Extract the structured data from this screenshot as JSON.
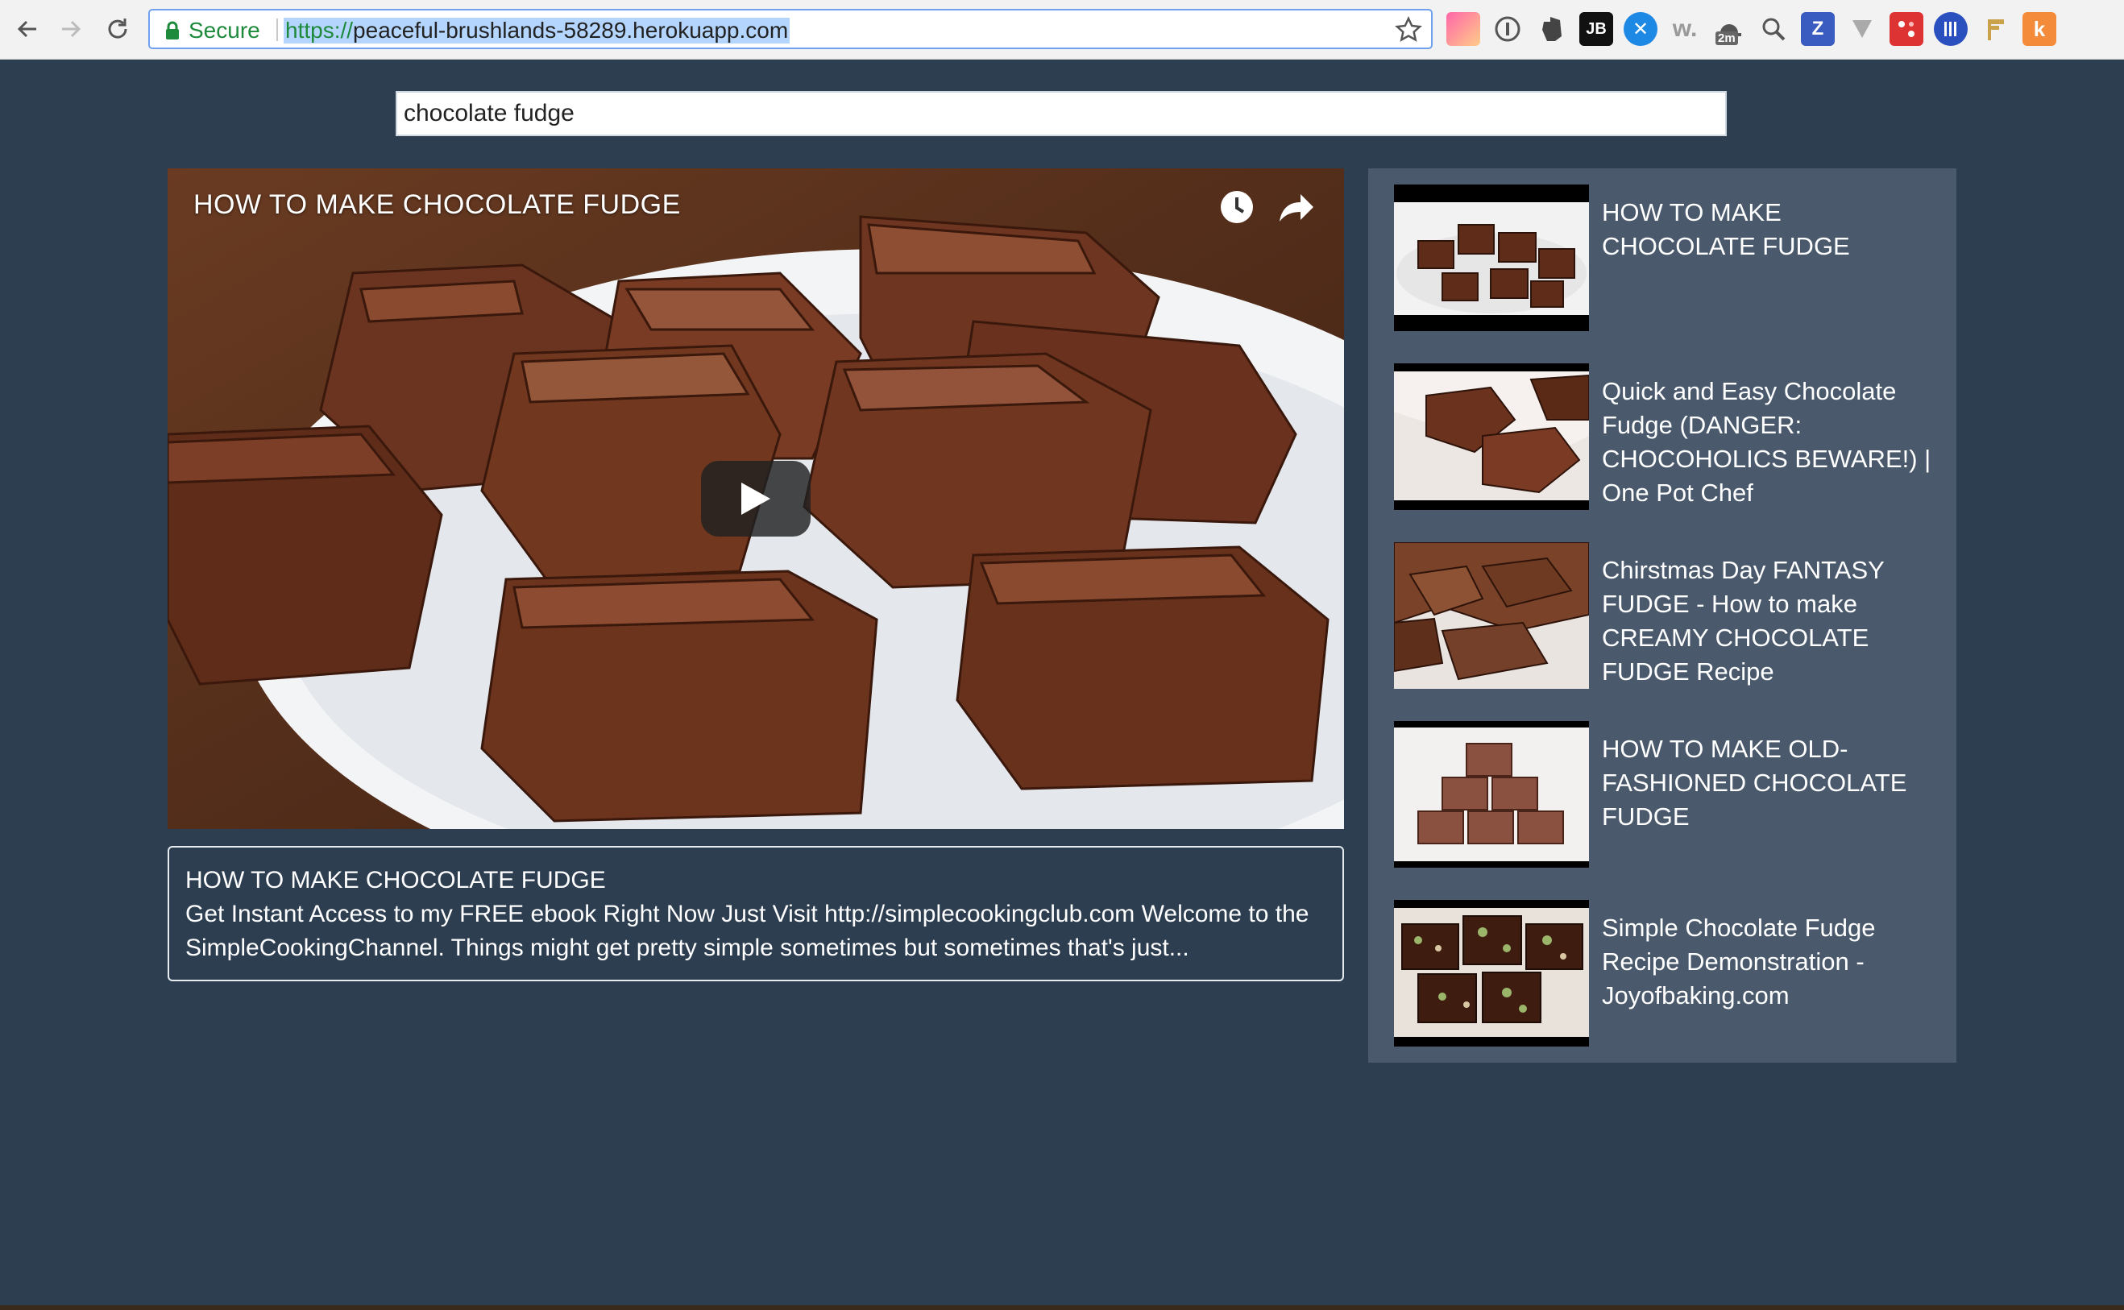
{
  "browser": {
    "secure_label": "Secure",
    "url_scheme": "https://",
    "url_host": "peaceful-brushlands-58289.herokuapp.com",
    "extension_badge": "2m",
    "extensions": [
      "paint-icon",
      "info-icon",
      "evernote-icon",
      "jetbrains-icon",
      "ball-icon",
      "w-icon",
      "hat-icon",
      "zoom-icon",
      "z-icon",
      "v-icon",
      "grid-icon",
      "stripes-icon",
      "flag-icon",
      "hubspot-icon"
    ]
  },
  "search": {
    "value": "chocolate fudge"
  },
  "player": {
    "title": "HOW TO MAKE CHOCOLATE FUDGE"
  },
  "description": {
    "title": "HOW TO MAKE CHOCOLATE FUDGE",
    "text": "Get Instant Access to my FREE ebook Right Now Just Visit http://simplecookingclub.com Welcome to the SimpleCookingChannel. Things might get pretty simple sometimes but sometimes that's just..."
  },
  "sidebar": {
    "items": [
      {
        "title": "HOW TO MAKE CHOCOLATE FUDGE"
      },
      {
        "title": "Quick and Easy Chocolate Fudge (DANGER: CHOCOHOLICS BEWARE!) | One Pot Chef"
      },
      {
        "title": "Chirstmas Day FANTASY FUDGE - How to make CREAMY CHOCOLATE FUDGE Recipe"
      },
      {
        "title": "HOW TO MAKE OLD-FASHIONED CHOCOLATE FUDGE"
      },
      {
        "title": "Simple Chocolate Fudge Recipe Demonstration - Joyofbaking.com"
      }
    ]
  },
  "colors": {
    "page_bg": "#2e3e51",
    "sidebar_bg": "#4a5a6c",
    "secure_green": "#1e8a3c",
    "fudge": "#6b3420"
  }
}
